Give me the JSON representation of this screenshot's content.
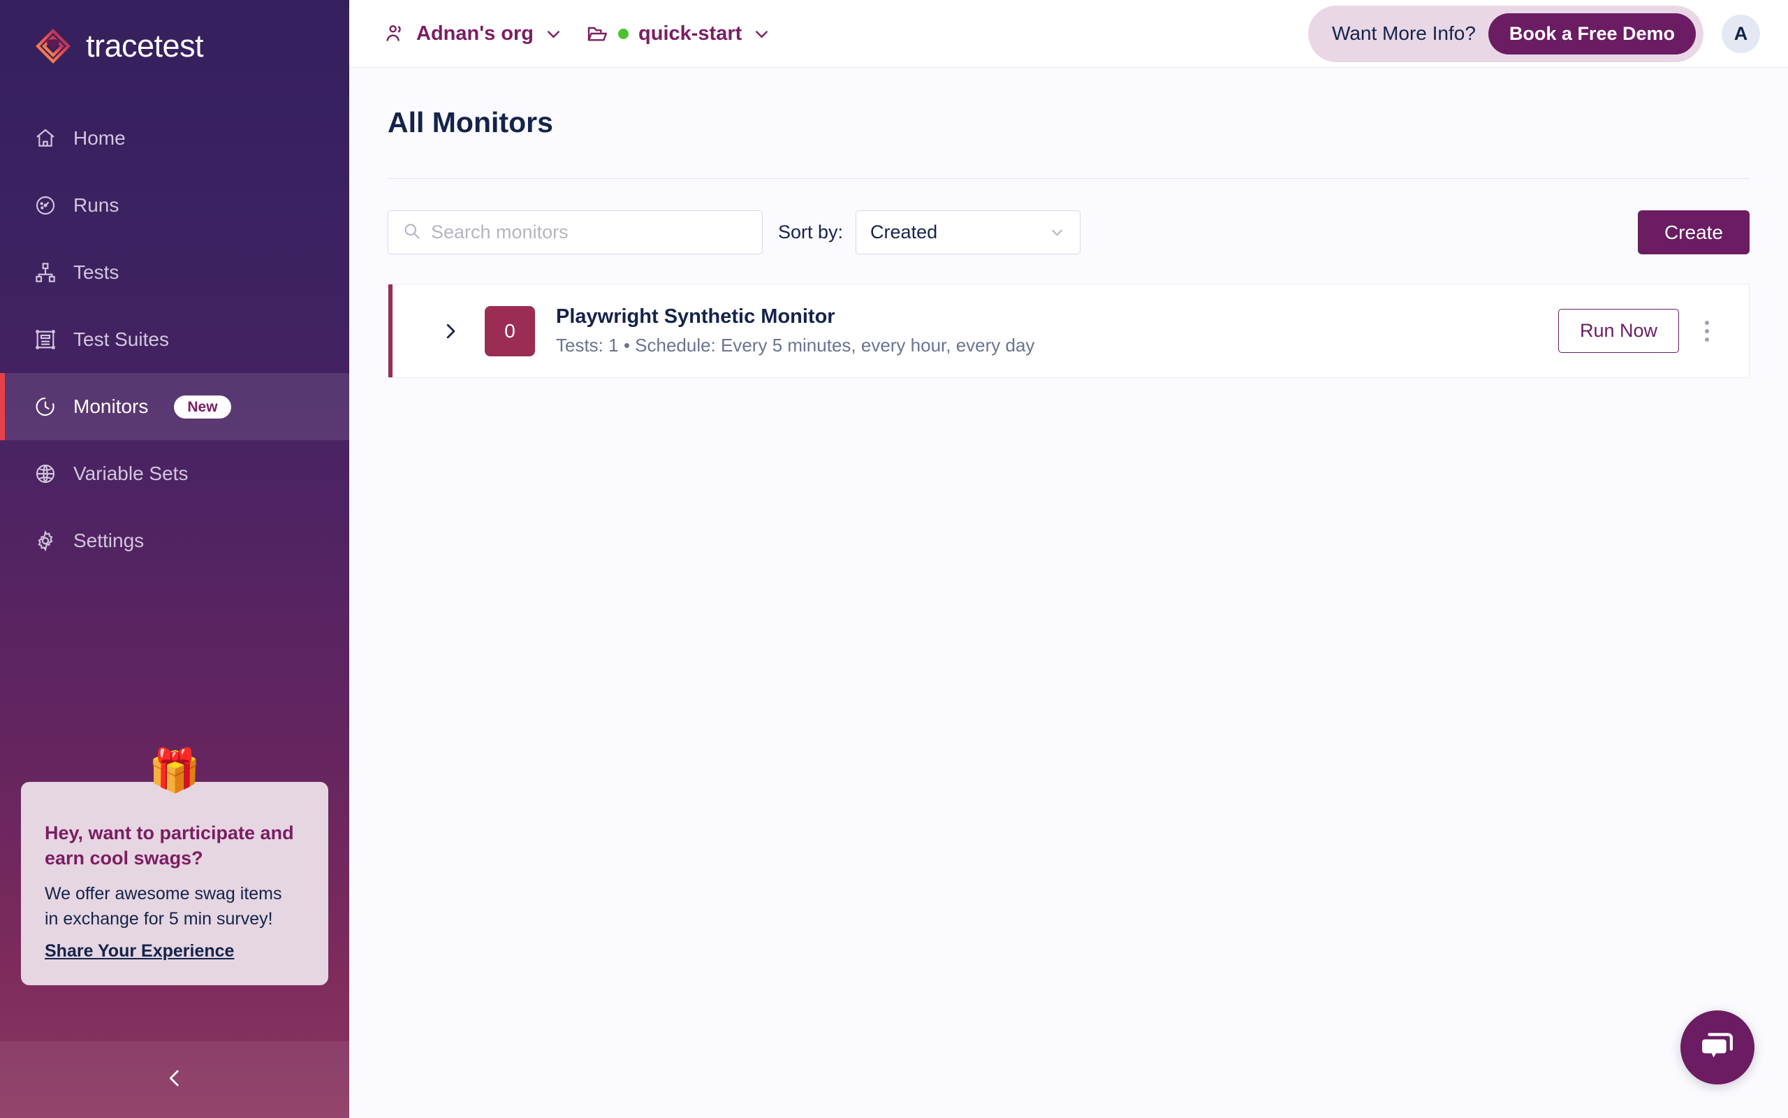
{
  "brand": {
    "name": "tracetest",
    "accent": "#6B1C63",
    "active_accent": "#E8404A",
    "maroon": "#9B2D54"
  },
  "sidebar": {
    "items": [
      {
        "label": "Home",
        "icon": "home-icon",
        "active": false,
        "badge": ""
      },
      {
        "label": "Runs",
        "icon": "gauge-icon",
        "active": false,
        "badge": ""
      },
      {
        "label": "Tests",
        "icon": "hierarchy-icon",
        "active": false,
        "badge": ""
      },
      {
        "label": "Test Suites",
        "icon": "suite-icon",
        "active": false,
        "badge": ""
      },
      {
        "label": "Monitors",
        "icon": "clock-icon",
        "active": true,
        "badge": "New"
      },
      {
        "label": "Variable Sets",
        "icon": "globe-icon",
        "active": false,
        "badge": ""
      },
      {
        "label": "Settings",
        "icon": "gear-icon",
        "active": false,
        "badge": ""
      }
    ],
    "promo": {
      "gift_icon": "gift-emoji",
      "heading": "Hey, want to participate and earn cool swags?",
      "body_line1": "We offer awesome swag items",
      "body_line2": "in exchange for 5 min survey!",
      "link": "Share Your Experience"
    },
    "collapse_icon": "chevron-left-icon"
  },
  "topbar": {
    "org": {
      "icon": "people-icon",
      "name": "Adnan's org",
      "chevron": "chevron-down-icon"
    },
    "project": {
      "icon": "folder-icon",
      "status_dot": "#4BC230",
      "name": "quick-start",
      "chevron": "chevron-down-icon"
    },
    "promo_text": "Want More Info?",
    "demo_button": "Book a Free Demo",
    "avatar_initial": "A"
  },
  "page": {
    "title": "All Monitors"
  },
  "toolbar": {
    "search_placeholder": "Search monitors",
    "search_value": "",
    "search_icon": "search-icon",
    "sort_label": "Sort by:",
    "sort_value": "Created",
    "sort_options": [
      "Created"
    ],
    "create_label": "Create"
  },
  "monitors": [
    {
      "expander_icon": "chevron-right-icon",
      "count": "0",
      "title": "Playwright Synthetic Monitor",
      "subtitle": "Tests: 1 • Schedule: Every 5 minutes, every hour, every day",
      "run_label": "Run Now",
      "menu_icon": "kebab-menu-icon"
    }
  ],
  "chat": {
    "icon": "chat-bubble-icon"
  }
}
